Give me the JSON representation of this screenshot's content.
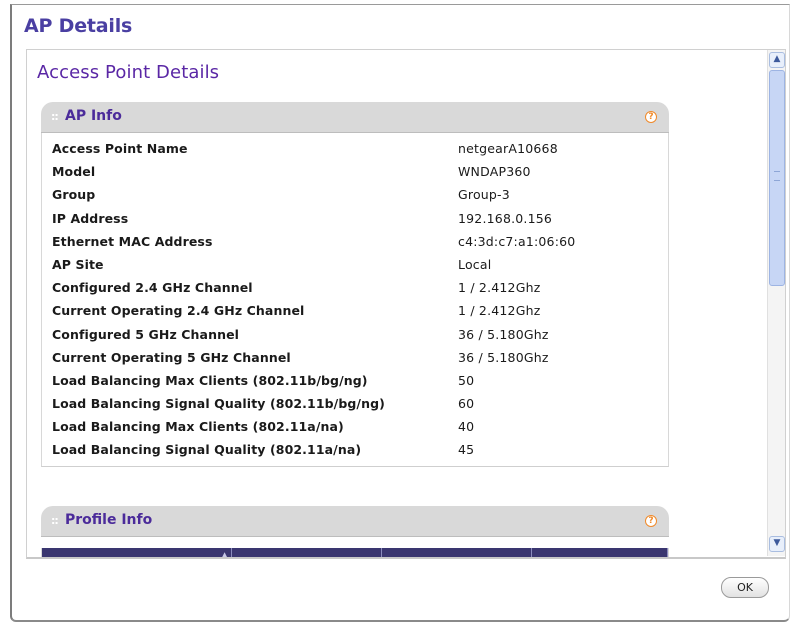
{
  "window": {
    "title": "AP Details"
  },
  "page": {
    "title": "Access Point Details"
  },
  "ap_info": {
    "title": "AP Info",
    "help_icon": "?",
    "rows": [
      {
        "label": "Access Point Name",
        "value": "netgearA10668"
      },
      {
        "label": "Model",
        "value": "WNDAP360"
      },
      {
        "label": "Group",
        "value": "Group-3"
      },
      {
        "label": "IP Address",
        "value": "192.168.0.156"
      },
      {
        "label": "Ethernet MAC Address",
        "value": "c4:3d:c7:a1:06:60"
      },
      {
        "label": "AP Site",
        "value": "Local"
      },
      {
        "label": "Configured 2.4 GHz Channel",
        "value": "1 / 2.412Ghz"
      },
      {
        "label": "Current Operating 2.4 GHz Channel",
        "value": "1 / 2.412Ghz"
      },
      {
        "label": "Configured 5 GHz Channel",
        "value": "36 / 5.180Ghz"
      },
      {
        "label": "Current Operating 5 GHz Channel",
        "value": "36 / 5.180Ghz"
      },
      {
        "label": "Load Balancing Max Clients (802.11b/bg/ng)",
        "value": "50"
      },
      {
        "label": "Load Balancing Signal Quality (802.11b/bg/ng)",
        "value": "60"
      },
      {
        "label": "Load Balancing Max Clients (802.11a/na)",
        "value": "40"
      },
      {
        "label": "Load Balancing Signal Quality (802.11a/na)",
        "value": "45"
      }
    ]
  },
  "profile_info": {
    "title": "Profile Info",
    "help_icon": "?",
    "columns": [
      "",
      "",
      "",
      ""
    ]
  },
  "scrollbar": {
    "up_icon": "▲",
    "down_icon": "▼"
  },
  "buttons": {
    "ok": "OK"
  },
  "colors": {
    "title": "#4a3fa2",
    "panel_header": "#d9d9d9",
    "table_header": "#3a3670",
    "help": "#f08a2a"
  }
}
